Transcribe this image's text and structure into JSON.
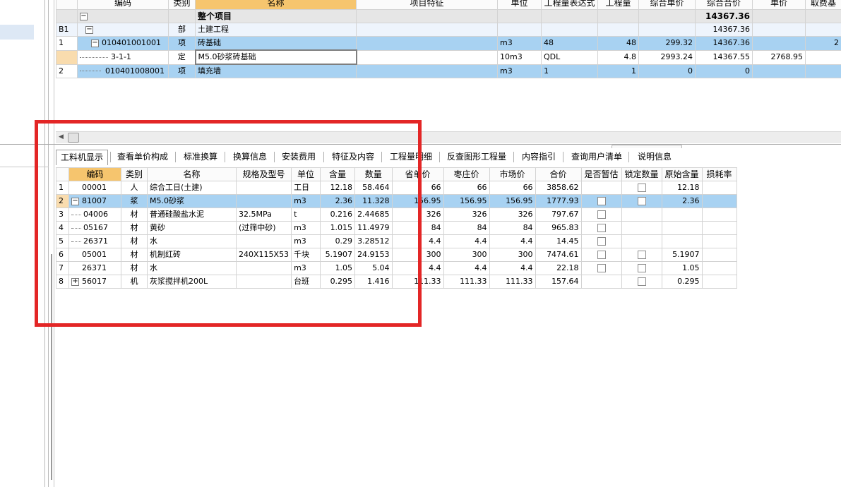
{
  "top_grid": {
    "columns": [
      "编码",
      "类别",
      "名称",
      "项目特征",
      "单位",
      "工程量表达式",
      "工程量",
      "综合单价",
      "综合合价",
      "单价",
      "取费基"
    ],
    "rows": [
      {
        "rownum": "",
        "code": "",
        "type": "",
        "name": "整个项目",
        "feature": "",
        "unit": "",
        "expr": "",
        "qty": "",
        "price": "",
        "total": "14367.36",
        "uprice": "",
        "extra": ""
      },
      {
        "rownum": "B1",
        "code": "",
        "type": "部",
        "name": "土建工程",
        "feature": "",
        "unit": "",
        "expr": "",
        "qty": "",
        "price": "",
        "total": "14367.36",
        "uprice": "",
        "extra": ""
      },
      {
        "rownum": "1",
        "code": "010401001001",
        "type": "项",
        "name": "砖基础",
        "feature": "",
        "unit": "m3",
        "expr": "48",
        "qty": "48",
        "price": "299.32",
        "total": "14367.36",
        "uprice": "",
        "extra": "2"
      },
      {
        "rownum": "",
        "code": "3-1-1",
        "type": "定",
        "name": "M5.0砂浆砖基础",
        "feature": "",
        "unit": "10m3",
        "expr": "QDL",
        "qty": "4.8",
        "price": "2993.24",
        "total": "14367.55",
        "uprice": "2768.95",
        "extra": ""
      },
      {
        "rownum": "2",
        "code": "010401008001",
        "type": "项",
        "name": "填充墙",
        "feature": "",
        "unit": "m3",
        "expr": "1",
        "qty": "1",
        "price": "0",
        "total": "0",
        "uprice": "",
        "extra": ""
      }
    ]
  },
  "tabs": [
    "工料机显示",
    "查看单价构成",
    "标准换算",
    "换算信息",
    "安装费用",
    "特征及内容",
    "工程量明细",
    "反查图形工程量",
    "内容指引",
    "查询用户清单",
    "说明信息"
  ],
  "bottom_grid": {
    "columns": [
      "编码",
      "类别",
      "名称",
      "规格及型号",
      "单位",
      "含量",
      "数量",
      "省单价",
      "枣庄价",
      "市场价",
      "合价",
      "是否暂估",
      "锁定数量",
      "原始含量",
      "损耗率"
    ],
    "rows": [
      {
        "rownum": "1",
        "code": "00001",
        "type": "人",
        "name": "综合工日(土建)",
        "spec": "",
        "unit": "工日",
        "content": "12.18",
        "qty": "58.464",
        "prov": "66",
        "zz": "66",
        "market": "66",
        "total": "3858.62",
        "est": false,
        "lock": true,
        "orig": "12.18",
        "loss": ""
      },
      {
        "rownum": "2",
        "code": "81007",
        "type": "浆",
        "name": "M5.0砂浆",
        "spec": "",
        "unit": "m3",
        "content": "2.36",
        "qty": "11.328",
        "prov": "156.95",
        "zz": "156.95",
        "market": "156.95",
        "total": "1777.93",
        "est": true,
        "lock": true,
        "orig": "2.36",
        "loss": ""
      },
      {
        "rownum": "3",
        "code": "04006",
        "type": "材",
        "name": "普通硅酸盐水泥",
        "spec": "32.5MPa",
        "unit": "t",
        "content": "0.216",
        "qty": "2.44685",
        "prov": "326",
        "zz": "326",
        "market": "326",
        "total": "797.67",
        "est": true,
        "lock": false,
        "orig": "",
        "loss": ""
      },
      {
        "rownum": "4",
        "code": "05167",
        "type": "材",
        "name": "黄砂",
        "spec": "(过筛中砂)",
        "unit": "m3",
        "content": "1.015",
        "qty": "11.4979",
        "prov": "84",
        "zz": "84",
        "market": "84",
        "total": "965.83",
        "est": true,
        "lock": false,
        "orig": "",
        "loss": ""
      },
      {
        "rownum": "5",
        "code": "26371",
        "type": "材",
        "name": "水",
        "spec": "",
        "unit": "m3",
        "content": "0.29",
        "qty": "3.28512",
        "prov": "4.4",
        "zz": "4.4",
        "market": "4.4",
        "total": "14.45",
        "est": true,
        "lock": false,
        "orig": "",
        "loss": ""
      },
      {
        "rownum": "6",
        "code": "05001",
        "type": "材",
        "name": "机制红砖",
        "spec": "240X115X53",
        "unit": "千块",
        "content": "5.1907",
        "qty": "24.9153",
        "prov": "300",
        "zz": "300",
        "market": "300",
        "total": "7474.61",
        "est": true,
        "lock": true,
        "orig": "5.1907",
        "loss": ""
      },
      {
        "rownum": "7",
        "code": "26371",
        "type": "材",
        "name": "水",
        "spec": "",
        "unit": "m3",
        "content": "1.05",
        "qty": "5.04",
        "prov": "4.4",
        "zz": "4.4",
        "market": "4.4",
        "total": "22.18",
        "est": true,
        "lock": true,
        "orig": "1.05",
        "loss": ""
      },
      {
        "rownum": "8",
        "code": "56017",
        "type": "机",
        "name": "灰浆搅拌机200L",
        "spec": "",
        "unit": "台班",
        "content": "0.295",
        "qty": "1.416",
        "prov": "111.33",
        "zz": "111.33",
        "market": "111.33",
        "total": "157.64",
        "est": false,
        "lock": true,
        "orig": "0.295",
        "loss": ""
      }
    ]
  },
  "colors": {
    "header_highlight": "#f6c56e",
    "row_blue": "#a8d2f2",
    "row_selected_num": "#f9dcae",
    "annotation_red": "#e32626"
  }
}
